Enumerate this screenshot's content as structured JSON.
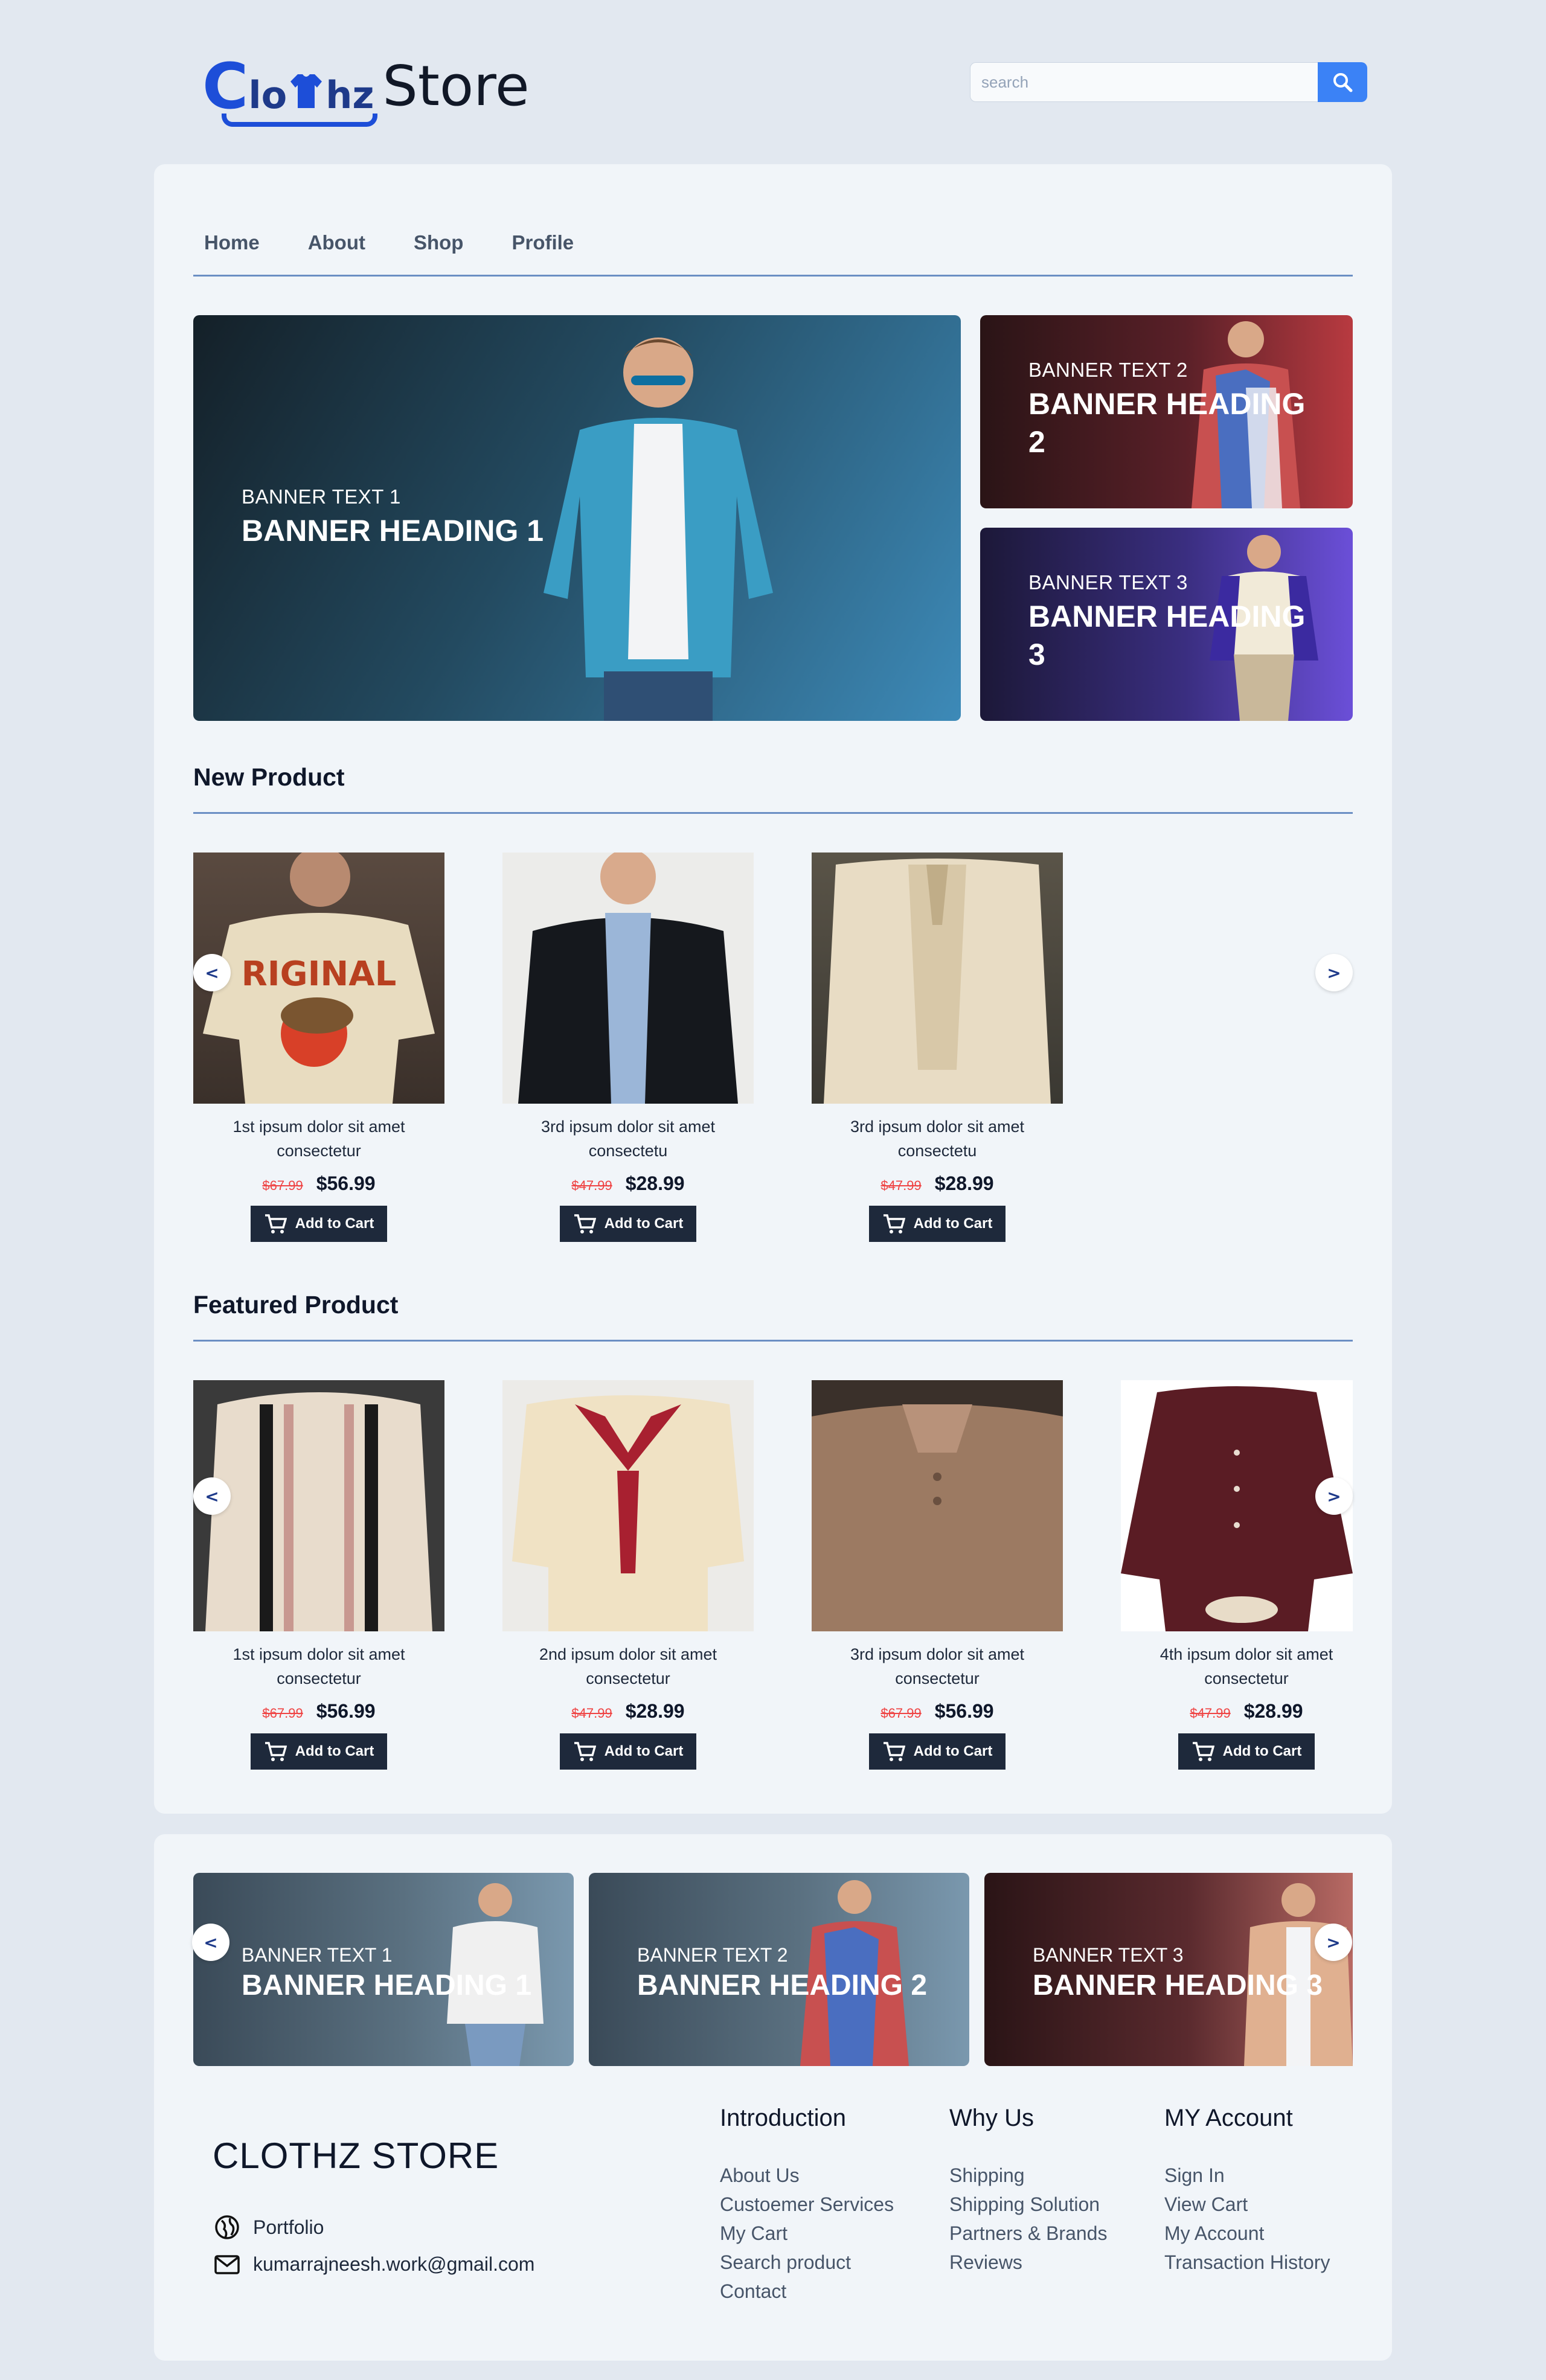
{
  "header": {
    "logo": {
      "c": "C",
      "lo": "lo",
      "hz": "hz",
      "store": "Store"
    },
    "search": {
      "placeholder": "search"
    }
  },
  "nav": {
    "items": [
      "Home",
      "About",
      "Shop",
      "Profile"
    ]
  },
  "hero_banners": [
    {
      "small": "BANNER TEXT 1",
      "heading": "BANNER HEADING 1"
    },
    {
      "small": "BANNER TEXT 2",
      "heading_line1": "BANNER HEADING",
      "heading_line2": "2"
    },
    {
      "small": "BANNER TEXT 3",
      "heading_line1": "BANNER HEADING",
      "heading_line2": "3"
    }
  ],
  "new_products": {
    "title": "New Product",
    "items": [
      {
        "line1": "1st ipsum dolor sit amet",
        "line2": "consectetur",
        "old_price": "$67.99",
        "price": "$56.99",
        "button": "Add to Cart"
      },
      {
        "line1": "3rd ipsum dolor sit amet",
        "line2": "consectetu",
        "old_price": "$47.99",
        "price": "$28.99",
        "button": "Add to Cart"
      },
      {
        "line1": "3rd ipsum dolor sit amet",
        "line2": "consectetu",
        "old_price": "$47.99",
        "price": "$28.99",
        "button": "Add to Cart"
      }
    ]
  },
  "featured_products": {
    "title": "Featured Product",
    "items": [
      {
        "line1": "1st ipsum dolor sit amet",
        "line2": "consectetur",
        "old_price": "$67.99",
        "price": "$56.99",
        "button": "Add to Cart"
      },
      {
        "line1": "2nd ipsum dolor sit amet",
        "line2": "consectetur",
        "old_price": "$47.99",
        "price": "$28.99",
        "button": "Add to Cart"
      },
      {
        "line1": "3rd ipsum dolor sit amet",
        "line2": "consectetur",
        "old_price": "$67.99",
        "price": "$56.99",
        "button": "Add to Cart"
      },
      {
        "line1": "4th ipsum dolor sit amet",
        "line2": "consectetur",
        "old_price": "$47.99",
        "price": "$28.99",
        "button": "Add to Cart"
      }
    ]
  },
  "arrows": {
    "prev": "<",
    "next": ">"
  },
  "footer_banners": [
    {
      "small": "BANNER TEXT 1",
      "heading": "BANNER HEADING 1"
    },
    {
      "small": "BANNER TEXT 2",
      "heading": "BANNER HEADING 2"
    },
    {
      "small": "BANNER TEXT 3",
      "heading": "BANNER HEADING 3"
    }
  ],
  "footer": {
    "brand": "CLOTHZ STORE",
    "portfolio": "Portfolio",
    "email": "kumarrajneesh.work@gmail.com",
    "columns": [
      {
        "title": "Introduction",
        "links": [
          "About Us",
          "Custoemer Services",
          "My Cart",
          "Search product",
          "Contact"
        ]
      },
      {
        "title": "Why Us",
        "links": [
          "Shipping",
          "Shipping Solution",
          "Partners & Brands",
          "Reviews"
        ]
      },
      {
        "title": "MY Account",
        "links": [
          "Sign In",
          "View Cart",
          "My Account",
          "Transaction History"
        ]
      }
    ]
  },
  "colors": {
    "page_bg": "#e2e8f0",
    "card_bg": "#f1f5f9",
    "accent_blue": "#3b82f6",
    "button_dark": "#1e293b",
    "old_price_red": "#ef4444"
  },
  "icons": [
    "search-icon",
    "cart-icon",
    "globe-icon",
    "mail-icon",
    "chevron-left-icon",
    "chevron-right-icon"
  ]
}
